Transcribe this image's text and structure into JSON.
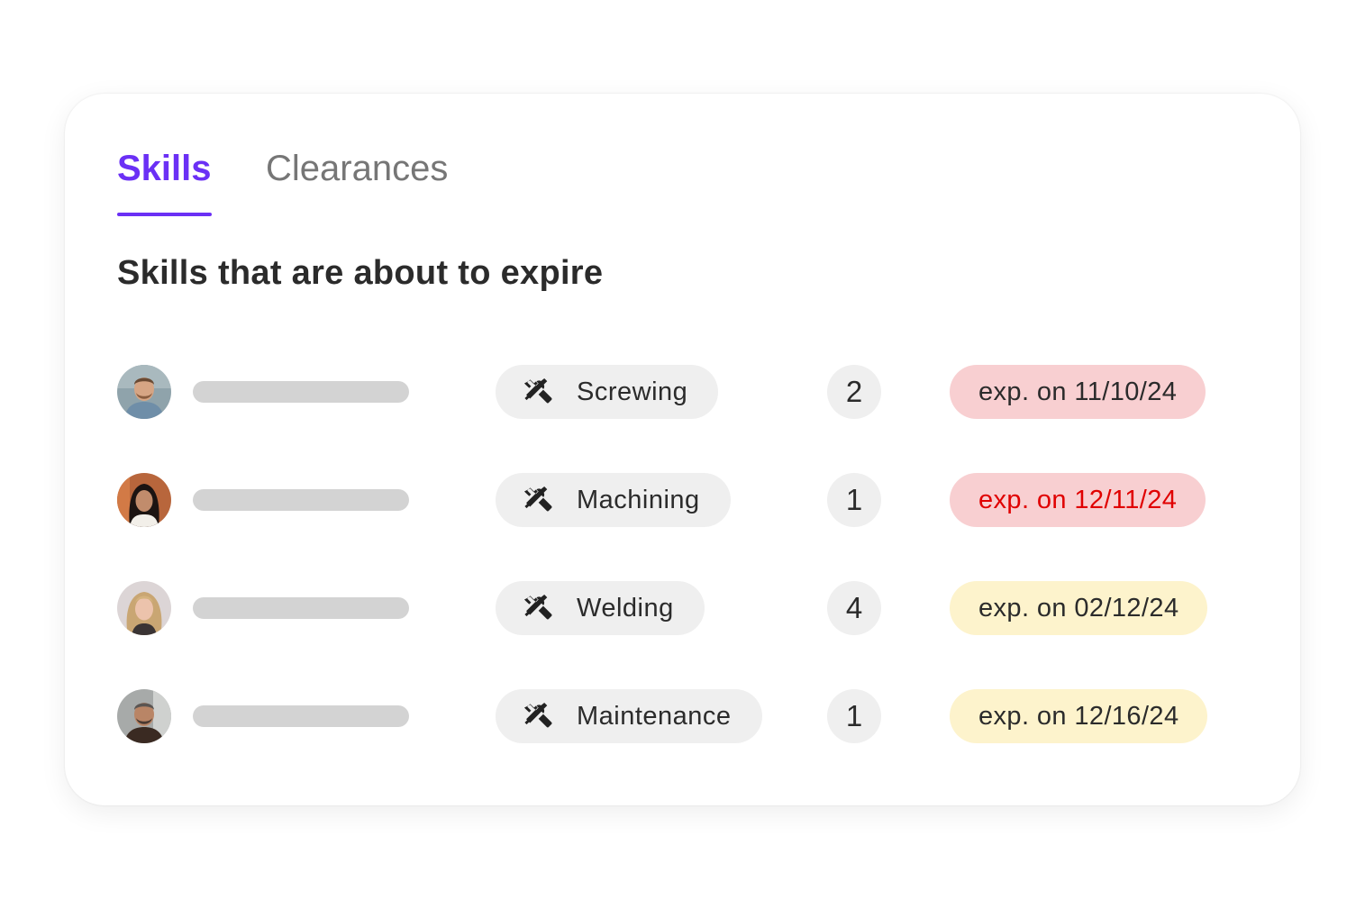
{
  "tabs": [
    {
      "label": "Skills",
      "active": true
    },
    {
      "label": "Clearances",
      "active": false
    }
  ],
  "section_title": "Skills that are about to expire",
  "colors": {
    "accent": "#6b30f5",
    "chip_bg": "#efefef",
    "expired_bg": "#f8cfd1",
    "warning_bg": "#fdf3cc",
    "alert_text": "#e00000",
    "text": "#2b2b2b"
  },
  "rows": [
    {
      "skill": "Screwing",
      "icon": "tools-icon",
      "count": "2",
      "expiry": "exp. on 11/10/24",
      "status": "expired"
    },
    {
      "skill": "Machining",
      "icon": "tools-icon",
      "count": "1",
      "expiry": "exp. on 12/11/24",
      "status": "expired-alert"
    },
    {
      "skill": "Welding",
      "icon": "tools-icon",
      "count": "4",
      "expiry": "exp. on 02/12/24",
      "status": "warning"
    },
    {
      "skill": "Maintenance",
      "icon": "tools-icon",
      "count": "1",
      "expiry": "exp. on 12/16/24",
      "status": "warning"
    }
  ]
}
